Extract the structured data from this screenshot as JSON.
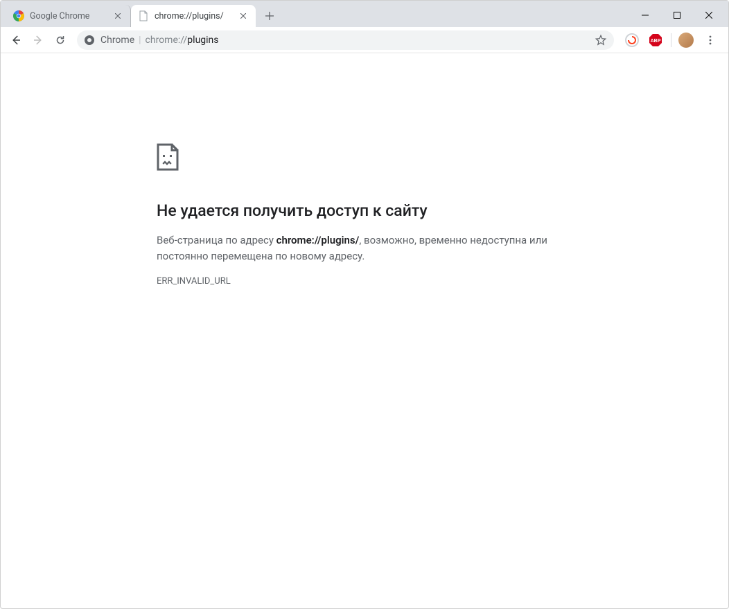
{
  "window": {
    "minimize_glyph": "—",
    "maximize_glyph": "☐",
    "close_glyph": "✕"
  },
  "tabs": [
    {
      "title": "Google Chrome",
      "active": false
    },
    {
      "title": "chrome://plugins/",
      "active": true
    }
  ],
  "toolbar": {
    "scheme_label": "Chrome",
    "url_prefix": "chrome://",
    "url_bold": "plugins"
  },
  "error": {
    "title": "Не удается получить доступ к сайту",
    "desc_before": "Веб-страница по адресу ",
    "desc_url": "chrome://plugins/",
    "desc_after": ", возможно, временно недоступна или постоянно перемещена по новому адресу.",
    "code": "ERR_INVALID_URL"
  }
}
